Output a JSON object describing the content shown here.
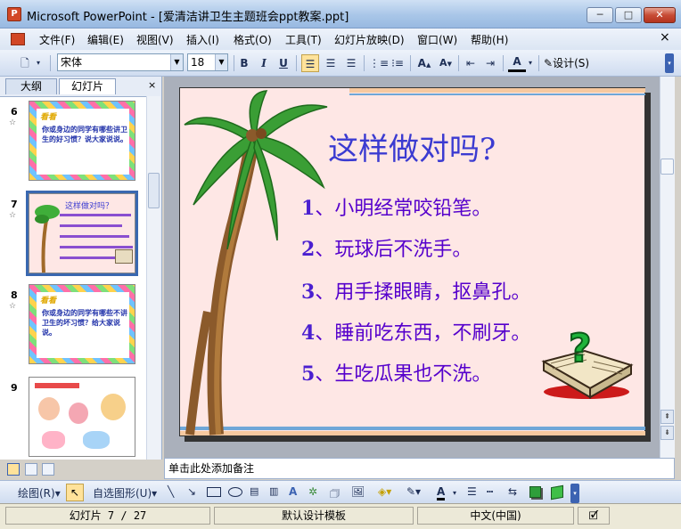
{
  "window": {
    "title": "Microsoft PowerPoint - [爱清洁讲卫生主题班会ppt教案.ppt]",
    "minimize": "─",
    "maximize": "□",
    "close": "✕",
    "doc_close": "×"
  },
  "menu": [
    "文件(F)",
    "编辑(E)",
    "视图(V)",
    "插入(I)",
    "格式(O)",
    "工具(T)",
    "幻灯片放映(D)",
    "窗口(W)",
    "帮助(H)"
  ],
  "toolbar": {
    "font_name": "宋体",
    "font_size": "18",
    "bold": "B",
    "italic": "I",
    "underline": "U",
    "font_color_label": "A",
    "design_label": "设计(S)"
  },
  "panel": {
    "tabs": [
      "大纲",
      "幻灯片"
    ],
    "close": "×",
    "thumbnails": [
      {
        "number": "6",
        "star": "☆",
        "heading": "看看",
        "text": "你或身边的同学有哪些讲卫生的好习惯？说大家说说。"
      },
      {
        "number": "7",
        "star": "☆",
        "heading": "这样做对吗？",
        "text": ""
      },
      {
        "number": "8",
        "star": "☆",
        "heading": "看看",
        "text": "你或身边的同学有哪些不讲卫生的坏习惯？给大家说说。"
      },
      {
        "number": "9",
        "star": "",
        "heading": "",
        "text": ""
      }
    ]
  },
  "slide": {
    "title": "这样做对吗?",
    "lines": [
      {
        "num": "1",
        "text": "、小明经常咬铅笔。"
      },
      {
        "num": "2",
        "text": "、玩球后不洗手。"
      },
      {
        "num": "3",
        "text": "、用手揉眼睛，抠鼻孔。"
      },
      {
        "num": "4",
        "text": "、睡前吃东西，不刷牙。"
      },
      {
        "num": "5",
        "text": "、生吃瓜果也不洗。"
      }
    ]
  },
  "notes_placeholder": "单击此处添加备注",
  "drawbar": {
    "draw_label": "绘图(R)",
    "autoshape_label": "自选图形(U)"
  },
  "status": {
    "slide": "幻灯片 7 / 27",
    "template": "默认设计模板",
    "language": "中文(中国)"
  },
  "colors": {
    "slide_bg": "#fee7e5",
    "slide_title": "#3b3bd1",
    "slide_text": "#5500cc"
  }
}
